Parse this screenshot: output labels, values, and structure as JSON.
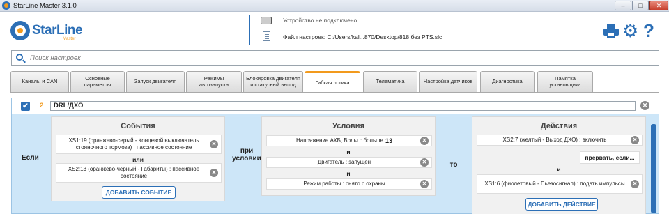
{
  "window": {
    "title": "StarLine Master 3.1.0",
    "min": "–",
    "max": "□",
    "close": "✕"
  },
  "header": {
    "brand": "StarLine",
    "brand_sub": "Master",
    "device_status": "Устройство не подключено",
    "file_path": "Файл настроек: C:/Users/kal...870/Desktop/818 без PTS.slc",
    "icons": [
      "printer-icon",
      "gear-icon",
      "help-icon"
    ],
    "gear_glyph": "⚙",
    "help_glyph": "?"
  },
  "search": {
    "placeholder": "Поиск настроек"
  },
  "tabs": [
    {
      "label": "Каналы и CAN"
    },
    {
      "label": "Основные параметры"
    },
    {
      "label": "Запуск двигателя"
    },
    {
      "label": "Режимы автозапуска"
    },
    {
      "label": "Блокировка двигателя и статусный выход"
    },
    {
      "label": "Гибкая логика",
      "active": true
    },
    {
      "label": "Телематика"
    },
    {
      "label": "Настройка датчиков"
    },
    {
      "label": "Диагностика"
    },
    {
      "label": "Памятка установщика"
    }
  ],
  "rule": {
    "checked": "✔",
    "number": "2",
    "name": "DRL/ДХО",
    "delete": "✕",
    "kw_if": "Если",
    "kw_cond": "при условии",
    "kw_then": "то",
    "events": {
      "title": "События",
      "items": [
        "XS1:19 (оранжево-серый - Концевой выключатель стояночного тормоза) : пассивное состояние",
        "XS2:13 (оранжево-черный - Габариты) : пассивное состояние"
      ],
      "connector": "или",
      "add_label": "ДОБАВИТЬ СОБЫТИЕ"
    },
    "conditions": {
      "title": "Условия",
      "items": [
        {
          "text": "Напряжение АКБ, Вольт : больше",
          "value": "13"
        },
        {
          "text": "Двигатель : запущен",
          "value": ""
        },
        {
          "text": "Режим работы : снято с охраны",
          "value": ""
        }
      ],
      "connector": "и"
    },
    "actions": {
      "title": "Действия",
      "items": [
        "XS2:7 (желтый - Выход ДХО) : включить",
        "XS1:6 (фиолетовый - Пьезосигнал) : подать импульсы"
      ],
      "inverse_label": "прервать, если...",
      "connector": "и",
      "add_label": "ДОБАВИТЬ ДЕЙСТВИЕ"
    }
  },
  "colors": {
    "accent": "#2c6fb6",
    "highlight": "#f29a1d",
    "panel_bg": "#cde6f8"
  }
}
